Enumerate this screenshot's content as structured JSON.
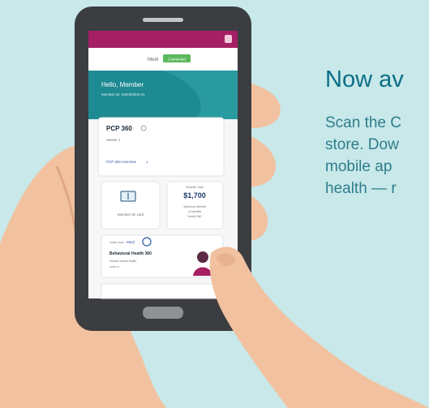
{
  "promo": {
    "heading": "Now av",
    "body_lines": [
      "Scan the C",
      "store. Dow",
      "mobile ap",
      "health — r"
    ]
  },
  "phone_screen": {
    "logo_text": "Medi",
    "status_badge": "Connected",
    "greeting": "Hello, Member",
    "member_id": "Member ID: 000000000-01",
    "pcp_card": {
      "title": "PCP 360",
      "subtitle": "Master 1",
      "link": "PCP 360 overview",
      "link_icon": "chevron-right-icon"
    },
    "id_card_tile": {
      "label": "Member ID card",
      "icon": "id-card-icon"
    },
    "balance_tile": {
      "caption": "Benefits Total",
      "amount": "$1,700",
      "desc_lines": [
        "Maximum Benefit",
        "of Invisible",
        "Health 360"
      ]
    },
    "behavioral_card": {
      "logo_caption": "Learn more",
      "logo_text": "Medi",
      "title": "Behavioral Health 360",
      "line1": "Holistic mental health",
      "line2": "Learn it"
    },
    "profile_icon": "user-icon",
    "home_button_icon": "home-button-icon"
  },
  "colors": {
    "background": "#c8e8e9",
    "heading": "#0b6f86",
    "body_text": "#2f7d8c",
    "app_header": "#a51f64",
    "hero_teal": "#1e8a92",
    "badge_green": "#5cb85c",
    "skin": "#f2c2a0",
    "phone_body": "#3b3d41"
  }
}
